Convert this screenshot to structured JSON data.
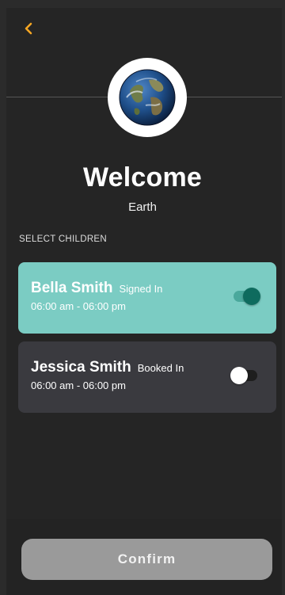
{
  "header": {
    "back_icon": "chevron-left-icon",
    "accent_color": "#f5a623"
  },
  "profile": {
    "avatar_icon": "earth-globe-icon",
    "title": "Welcome",
    "subtitle": "Earth"
  },
  "children_section": {
    "label": "SELECT CHILDREN",
    "children": [
      {
        "name": "Bella Smith",
        "status": "Signed In",
        "time": "06:00 am - 06:00 pm",
        "selected": true,
        "card_color": "#7bccc3"
      },
      {
        "name": "Jessica Smith",
        "status": "Booked In",
        "time": "06:00 am - 06:00 pm",
        "selected": false,
        "card_color": "#3a3a3f"
      }
    ]
  },
  "footer": {
    "confirm_label": "Confirm",
    "confirm_color": "#9a9a9a"
  }
}
